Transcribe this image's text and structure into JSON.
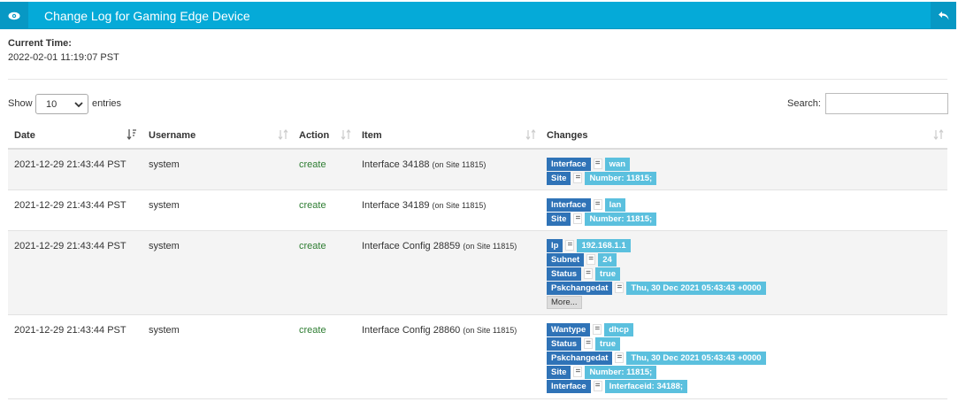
{
  "header": {
    "title": "Change Log for Gaming Edge Device",
    "accent": "#05aad8",
    "icons": [
      "eye-icon",
      "back-arrow-icon"
    ]
  },
  "current_time": {
    "label": "Current Time:",
    "value": "2022-02-01 11:19:07 PST"
  },
  "controls": {
    "show_label": "Show",
    "page_size": "10",
    "entries_label": "entries",
    "search_label": "Search:",
    "search_value": ""
  },
  "columns": [
    "Date",
    "Username",
    "Action",
    "Item",
    "Changes"
  ],
  "rows": [
    {
      "date": "2021-12-29 21:43:44 PST",
      "username": "system",
      "action": "create",
      "item": "Interface 34188",
      "site": "(on Site 11815)",
      "changes": [
        {
          "k": "Interface",
          "v": "wan"
        },
        {
          "k": "Site",
          "v": "Number: 11815;"
        }
      ],
      "more": ""
    },
    {
      "date": "2021-12-29 21:43:44 PST",
      "username": "system",
      "action": "create",
      "item": "Interface 34189",
      "site": "(on Site 11815)",
      "changes": [
        {
          "k": "Interface",
          "v": "lan"
        },
        {
          "k": "Site",
          "v": "Number: 11815;"
        }
      ],
      "more": ""
    },
    {
      "date": "2021-12-29 21:43:44 PST",
      "username": "system",
      "action": "create",
      "item": "Interface Config 28859",
      "site": "(on Site 11815)",
      "changes": [
        {
          "k": "Ip",
          "v": "192.168.1.1"
        },
        {
          "k": "Subnet",
          "v": "24"
        },
        {
          "k": "Status",
          "v": "true"
        },
        {
          "k": "Pskchangedat",
          "v": "Thu, 30 Dec 2021 05:43:43 +0000"
        }
      ],
      "more": "More..."
    },
    {
      "date": "2021-12-29 21:43:44 PST",
      "username": "system",
      "action": "create",
      "item": "Interface Config 28860",
      "site": "(on Site 11815)",
      "changes": [
        {
          "k": "Wantype",
          "v": "dhcp"
        },
        {
          "k": "Status",
          "v": "true"
        },
        {
          "k": "Pskchangedat",
          "v": "Thu, 30 Dec 2021 05:43:43 +0000"
        },
        {
          "k": "Site",
          "v": "Number: 11815;"
        },
        {
          "k": "Interface",
          "v": "Interfaceid: 34188;"
        }
      ],
      "more": ""
    }
  ]
}
